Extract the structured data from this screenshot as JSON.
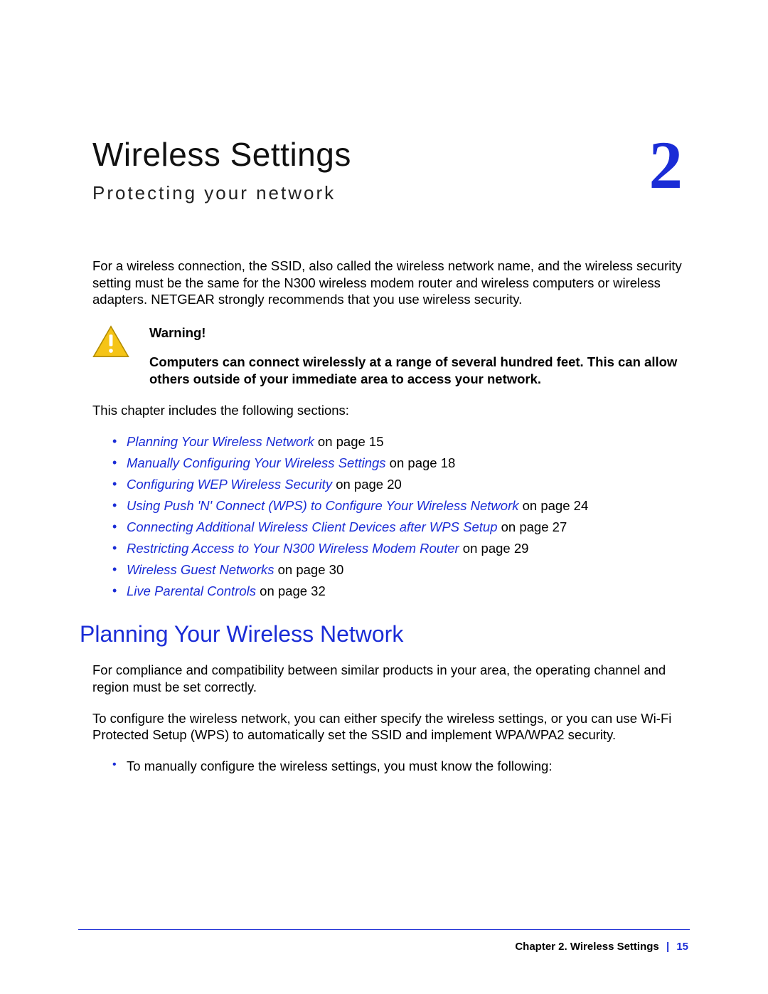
{
  "chapter": {
    "title": "Wireless Settings",
    "subtitle": "Protecting your network",
    "number": "2"
  },
  "intro": "For a wireless connection, the SSID, also called the wireless network name, and the wireless security setting must be the same for the N300 wireless modem router and wireless computers or wireless adapters. NETGEAR strongly recommends that you use wireless security.",
  "warning": {
    "label": "Warning!",
    "body": "Computers can connect wirelessly at a range of several hundred feet. This can allow others outside of your immediate area to access your network."
  },
  "toc_intro": "This chapter includes the following sections:",
  "toc": [
    {
      "title": "Planning Your Wireless Network",
      "suffix": " on page 15"
    },
    {
      "title": "Manually Configuring Your Wireless Settings",
      "suffix": " on page 18"
    },
    {
      "title": "Configuring WEP Wireless Security",
      "suffix": " on page 20"
    },
    {
      "title": "Using Push 'N' Connect (WPS) to Configure Your Wireless Network",
      "suffix": " on page 24"
    },
    {
      "title": "Connecting Additional Wireless Client Devices after WPS Setup",
      "suffix": " on page 27"
    },
    {
      "title": "Restricting Access to Your N300 Wireless Modem Router",
      "suffix": " on page 29"
    },
    {
      "title": "Wireless Guest Networks",
      "suffix": " on page 30"
    },
    {
      "title": "Live Parental Controls",
      "suffix": " on page 32"
    }
  ],
  "section": {
    "heading": "Planning Your Wireless Network",
    "p1": "For compliance and compatibility between similar products in your area, the operating channel and region must be set correctly.",
    "p2": "To configure the wireless network, you can either specify the wireless settings, or you can use Wi-Fi Protected Setup (WPS) to automatically set the SSID and implement WPA/WPA2 security.",
    "bullet1": "To manually configure the wireless settings, you must know the following:"
  },
  "footer": {
    "chapter": "Chapter 2.  Wireless Settings",
    "separator": "|",
    "page": "15"
  }
}
